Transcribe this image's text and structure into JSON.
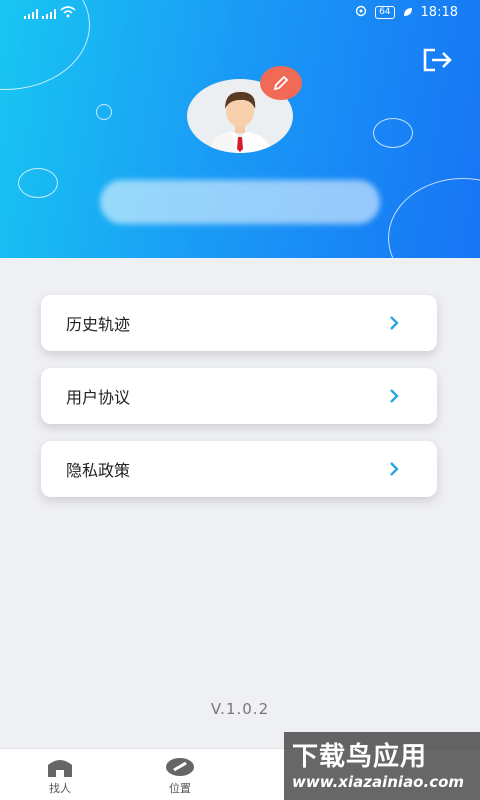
{
  "status_bar": {
    "left": "4G 4G",
    "battery": "64",
    "time": "18:18"
  },
  "menu": [
    {
      "label": "历史轨迹"
    },
    {
      "label": "用户协议"
    },
    {
      "label": "隐私政策"
    }
  ],
  "version": "V.1.0.2",
  "tabs": [
    {
      "label": "找人"
    },
    {
      "label": "位置"
    }
  ],
  "watermark": {
    "title": "下载鸟应用",
    "url": "www.xiazainiao.com"
  },
  "colors": {
    "header_start": "#18c6f2",
    "header_end": "#1774f5",
    "edit_badge": "#f06a55",
    "chevron": "#2aa7e0"
  }
}
